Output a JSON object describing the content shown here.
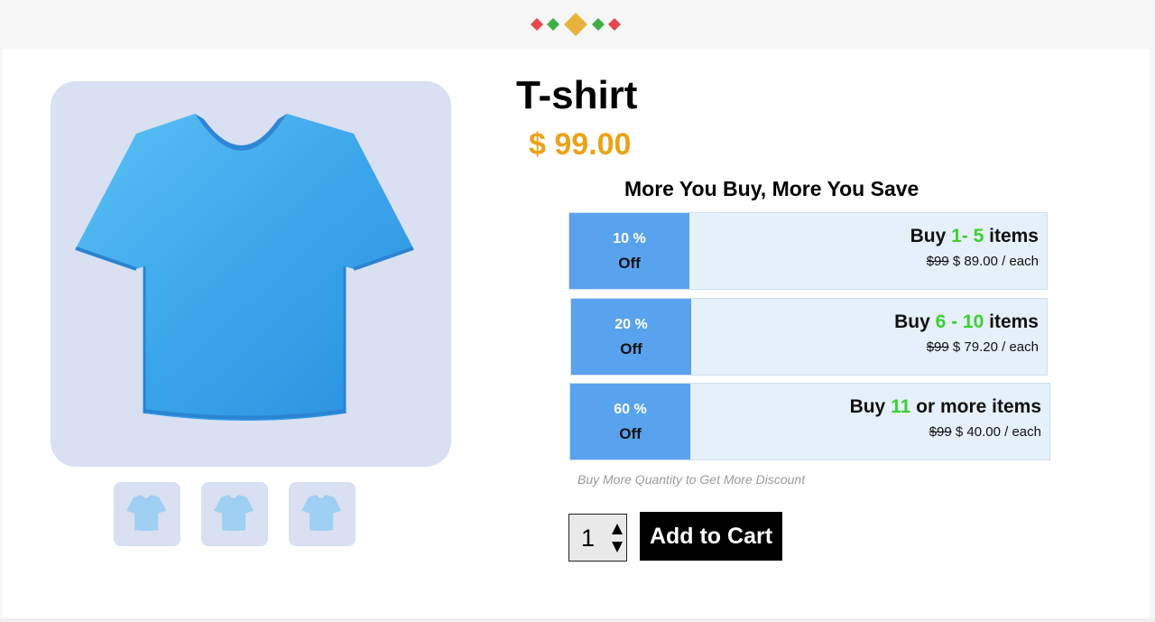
{
  "header": {
    "logo_icon": "diamond-cluster-logo",
    "logo_colors": [
      "#e5484d",
      "#3fae47",
      "#e8b23c"
    ]
  },
  "product": {
    "title": "T-shirt",
    "price": "$ 99.00",
    "image_icon": "tshirt-image",
    "image_color": "#3b9ee6",
    "thumbnails": [
      {
        "icon": "tshirt-thumbnail"
      },
      {
        "icon": "tshirt-thumbnail"
      },
      {
        "icon": "tshirt-thumbnail"
      }
    ]
  },
  "discount": {
    "heading": "More You Buy, More You Save",
    "tiers": [
      {
        "percent": "10 %",
        "off": "Off",
        "buy_prefix": "Buy ",
        "quantity": "1- 5",
        "buy_suffix": " items",
        "old_price": "$99",
        "new_price": " $ 89.00 / each"
      },
      {
        "percent": "20 %",
        "off": "Off",
        "buy_prefix": "Buy ",
        "quantity": "6 - 10",
        "buy_suffix": " items",
        "old_price": "$99",
        "new_price": " $ 79.20 / each"
      },
      {
        "percent": "60 %",
        "off": "Off",
        "buy_prefix": "Buy ",
        "quantity": "11",
        "buy_suffix": " or more items",
        "old_price": "$99",
        "new_price": " $ 40.00 / each"
      }
    ],
    "note": "Buy More Quantity to Get More Discount",
    "badge_color": "#59a2ee",
    "quantity_color": "#3ad12f"
  },
  "cart": {
    "quantity_value": "1",
    "add_label": "Add to Cart"
  }
}
